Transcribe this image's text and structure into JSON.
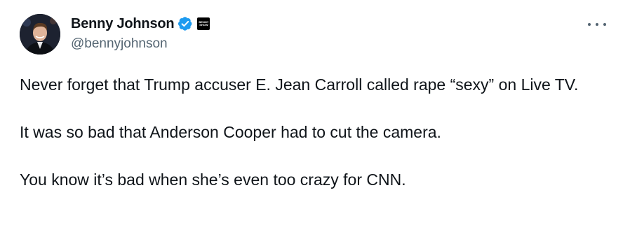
{
  "author": {
    "display_name": "Benny Johnson",
    "handle": "@bennyjohnson",
    "avatar_icon": "profile-photo",
    "verified_icon": "verified-badge-icon",
    "verified_color": "#1d9bf0",
    "affiliate_badge_text": "BENNY\nSHOW"
  },
  "more_icon": "more-options-icon",
  "tweet": {
    "paragraphs": [
      "Never forget that Trump accuser E. Jean Carroll called rape “sexy” on Live TV.",
      "It was so bad that Anderson Cooper had to cut the camera.",
      "You know it’s bad when she’s even too crazy for CNN."
    ]
  }
}
